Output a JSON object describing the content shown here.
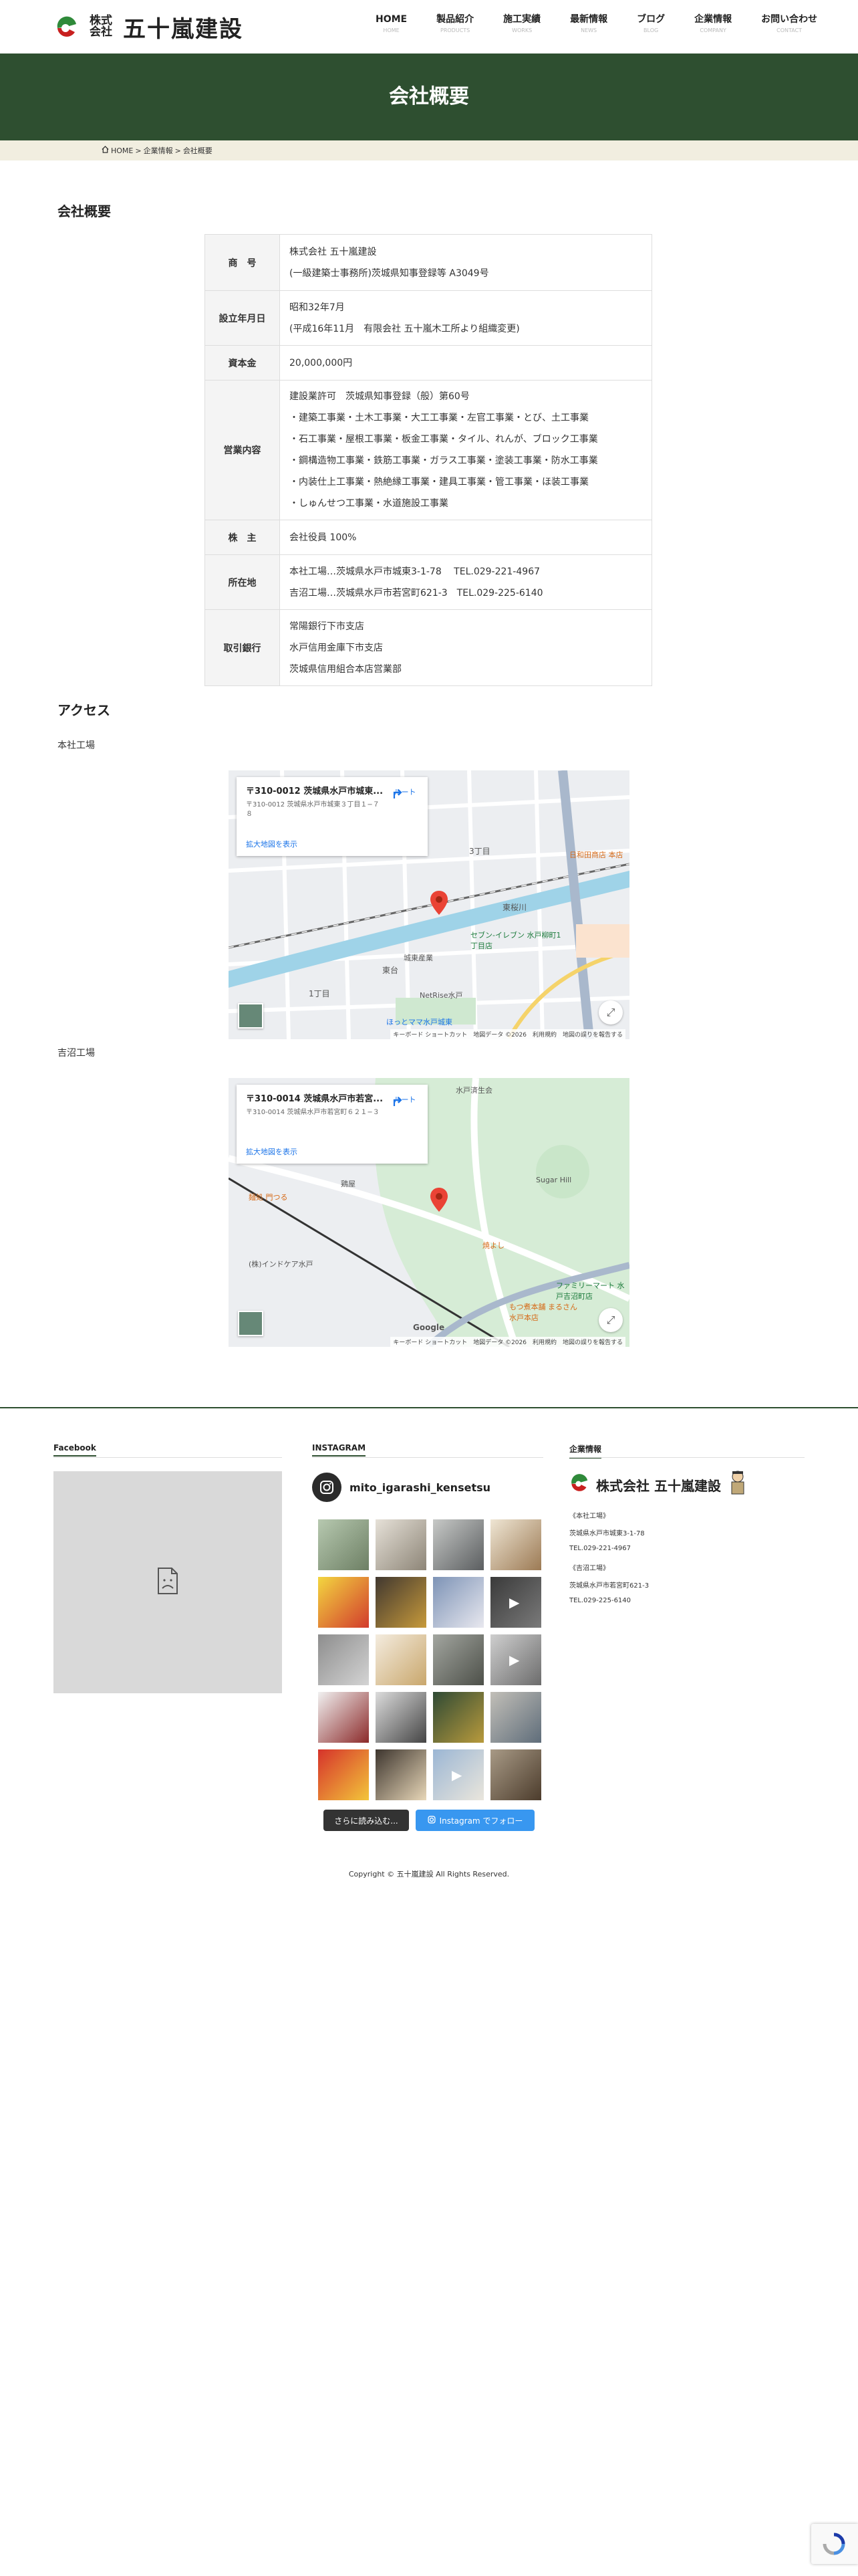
{
  "header": {
    "logo_kabu_1": "株式",
    "logo_kabu_2": "会社",
    "logo_name": "五十嵐建設",
    "nav": [
      {
        "label": "HOME",
        "sub": "HOME"
      },
      {
        "label": "製品紹介",
        "sub": "PRODUCTS"
      },
      {
        "label": "施工実績",
        "sub": "WORKS"
      },
      {
        "label": "最新情報",
        "sub": "NEWS"
      },
      {
        "label": "ブログ",
        "sub": "BLOG"
      },
      {
        "label": "企業情報",
        "sub": "COMPANY"
      },
      {
        "label": "お問い合わせ",
        "sub": "CONTACT"
      }
    ]
  },
  "hero": {
    "title": "会社概要"
  },
  "breadcrumb": {
    "home": "HOME",
    "sep1": ">",
    "company": "企業情報",
    "sep2": ">",
    "current": "会社概要"
  },
  "company": {
    "section_title": "会社概要",
    "rows": [
      {
        "label": "商　号",
        "lines": [
          "株式会社 五十嵐建設",
          "(一級建築士事務所)茨城県知事登録等 A3049号"
        ]
      },
      {
        "label": "設立年月日",
        "lines": [
          "昭和32年7月",
          "(平成16年11月　有限会社 五十嵐木工所より組織変更)"
        ]
      },
      {
        "label": "資本金",
        "lines": [
          "20,000,000円"
        ]
      },
      {
        "label": "営業内容",
        "lines": [
          "建設業許可　茨城県知事登録（般）第60号",
          "・建築工事業・土木工事業・大工工事業・左官工事業・とび、土工事業",
          "・石工事業・屋根工事業・板金工事業・タイル、れんが、ブロック工事業",
          "・鋼構造物工事業・鉄筋工事業・ガラス工事業・塗装工事業・防水工事業",
          "・内装仕上工事業・熱絶縁工事業・建具工事業・管工事業・ほ装工事業",
          "・しゅんせつ工事業・水道施設工事業"
        ]
      },
      {
        "label": "株　主",
        "lines": [
          "会社役員 100%"
        ]
      },
      {
        "label": "所在地",
        "lines": [
          "本社工場…茨城県水戸市城東3-1-78　 TEL.029-221-4967",
          "吉沼工場…茨城県水戸市若宮町621-3　TEL.029-225-6140"
        ]
      },
      {
        "label": "取引銀行",
        "lines": [
          "常陽銀行下市支店",
          "水戸信用金庫下市支店",
          "茨城県信用組合本店営業部"
        ]
      }
    ]
  },
  "access": {
    "section_title": "アクセス",
    "maps": [
      {
        "title": "本社工場",
        "card_addr": "〒310-0012 茨城県水戸市城東...",
        "card_sub": "〒310-0012 茨城県水戸市城東３丁目１−７８",
        "route": "ルート",
        "link": "拡大地図を表示",
        "labels": {
          "l1": "3丁目",
          "l2": "1丁目",
          "l3": "東台",
          "l4": "セブン-イレブン 水戸柳町1丁目店",
          "l5": "城東産業",
          "l6": "東桜川",
          "l7": "ほっとママ水戸城東",
          "l8": "日和田商店 本店",
          "l9": "NetRise水戸"
        },
        "footer": "キーボード ショートカット　地図データ ©2026　利用規約　地図の誤りを報告する"
      },
      {
        "title": "吉沼工場",
        "card_addr": "〒310-0014 茨城県水戸市若宮...",
        "card_sub": "〒310-0014 茨城県水戸市若宮町６２１−３",
        "route": "ルート",
        "link": "拡大地図を表示",
        "labels": {
          "l1": "水戸済生会",
          "l2": "Sugar Hill",
          "l3": "鶏屋",
          "l4": "麺処 門つる",
          "l5": "焼よし",
          "l6": "ファミリーマート 水戸吉沼町店",
          "l7": "もつ煮本舗 まるさん 水戸本店",
          "l8": "(株)インドケア水戸",
          "l9": "Google"
        },
        "footer": "キーボード ショートカット　地図データ ©2026　利用規約　地図の誤りを報告する"
      }
    ]
  },
  "footer": {
    "facebook_heading": "Facebook",
    "instagram_heading": "INSTAGRAM",
    "company_heading": "企業情報",
    "instagram_user": "mito_igarashi_kensetsu",
    "load_more": "さらに読み込む...",
    "follow": "Instagram でフォロー",
    "company_logo": "株式会社 五十嵐建設",
    "honsha_title": "《本社工場》",
    "honsha_addr": "茨城県水戸市城東3-1-78",
    "honsha_tel": "TEL.029-221-4967",
    "yoshinuma_title": "《吉沼工場》",
    "yoshinuma_addr": "茨城県水戸市若宮町621-3",
    "yoshinuma_tel": "TEL.029-225-6140",
    "copyright": "Copyright © 五十嵐建設 All Rights Reserved."
  },
  "colors": {
    "brand_green": "#2e4f30",
    "breadcrumb_bg": "#f1eee0",
    "instagram_blue": "#3897f0"
  },
  "icons": [
    "home-icon",
    "map-pin-icon",
    "directions-icon",
    "fullscreen-icon",
    "instagram-icon",
    "broken-image-icon",
    "recaptcha-icon"
  ]
}
